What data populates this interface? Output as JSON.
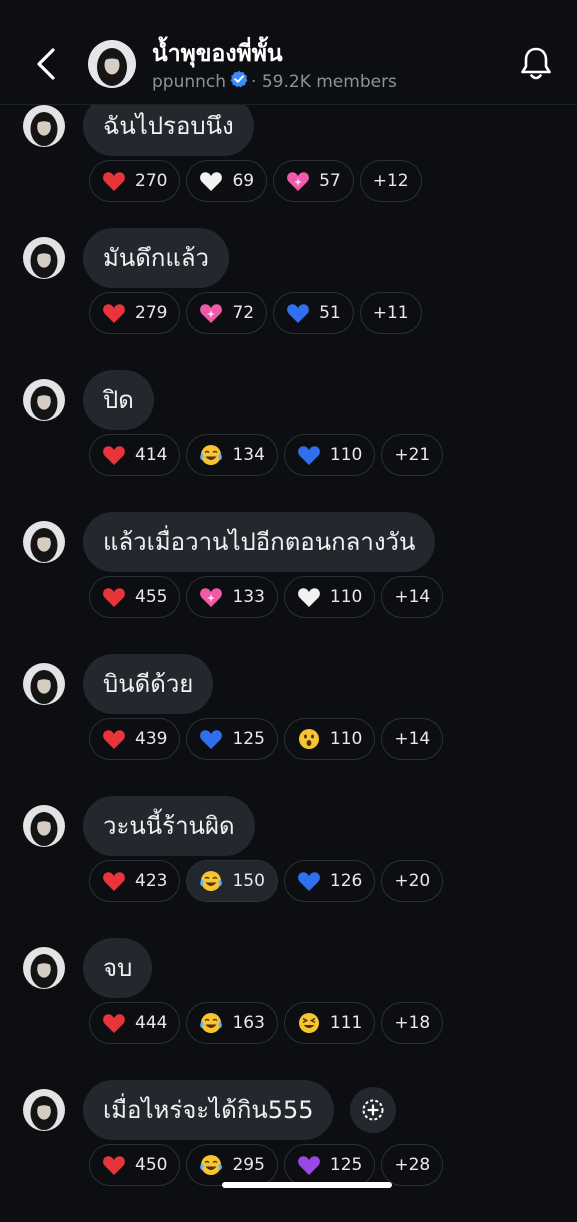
{
  "header": {
    "title": "น้ำพุของพี่พั้น",
    "handle": "ppunnch",
    "member_count": "· 59.2K members",
    "back_icon": "chevron-left-icon",
    "notify_icon": "bell-icon"
  },
  "colors": {
    "background": "#0c0e12",
    "bubble": "#24272d",
    "chip_border": "#2c3037",
    "verified": "#3b8cf3",
    "muted_text": "#8d9199"
  },
  "messages": [
    {
      "text": "ฉันไปรอบนึง",
      "reactions": [
        {
          "emoji": "red-heart",
          "count": "270"
        },
        {
          "emoji": "white-heart",
          "count": "69"
        },
        {
          "emoji": "sparkling-heart",
          "count": "57"
        }
      ],
      "more": "+12"
    },
    {
      "text": "มันดึกแล้ว",
      "reactions": [
        {
          "emoji": "red-heart",
          "count": "279"
        },
        {
          "emoji": "sparkling-heart",
          "count": "72"
        },
        {
          "emoji": "blue-heart",
          "count": "51"
        }
      ],
      "more": "+11"
    },
    {
      "text": "ปิด",
      "reactions": [
        {
          "emoji": "red-heart",
          "count": "414"
        },
        {
          "emoji": "tears-of-joy",
          "count": "134"
        },
        {
          "emoji": "blue-heart",
          "count": "110"
        }
      ],
      "more": "+21"
    },
    {
      "text": "แล้วเมื่อวานไปอีกตอนกลางวัน",
      "reactions": [
        {
          "emoji": "red-heart",
          "count": "455"
        },
        {
          "emoji": "sparkling-heart",
          "count": "133"
        },
        {
          "emoji": "white-heart",
          "count": "110"
        }
      ],
      "more": "+14"
    },
    {
      "text": "บินดีด้วย",
      "reactions": [
        {
          "emoji": "red-heart",
          "count": "439"
        },
        {
          "emoji": "blue-heart",
          "count": "125"
        },
        {
          "emoji": "surprised-face",
          "count": "110"
        }
      ],
      "more": "+14"
    },
    {
      "text": "วะนนี้ร้านผิด",
      "reactions": [
        {
          "emoji": "red-heart",
          "count": "423"
        },
        {
          "emoji": "tears-of-joy",
          "count": "150",
          "active": true
        },
        {
          "emoji": "blue-heart",
          "count": "126"
        }
      ],
      "more": "+20"
    },
    {
      "text": "จบ",
      "reactions": [
        {
          "emoji": "red-heart",
          "count": "444"
        },
        {
          "emoji": "tears-of-joy",
          "count": "163"
        },
        {
          "emoji": "squinting-face",
          "count": "111"
        }
      ],
      "more": "+18"
    },
    {
      "text": "เมื่อไหร่จะได้กิน555",
      "reactions": [
        {
          "emoji": "red-heart",
          "count": "450"
        },
        {
          "emoji": "tears-of-joy",
          "count": "295"
        },
        {
          "emoji": "purple-heart",
          "count": "125"
        }
      ],
      "more": "+28",
      "add_reaction_icon": "add-reaction-icon"
    }
  ]
}
